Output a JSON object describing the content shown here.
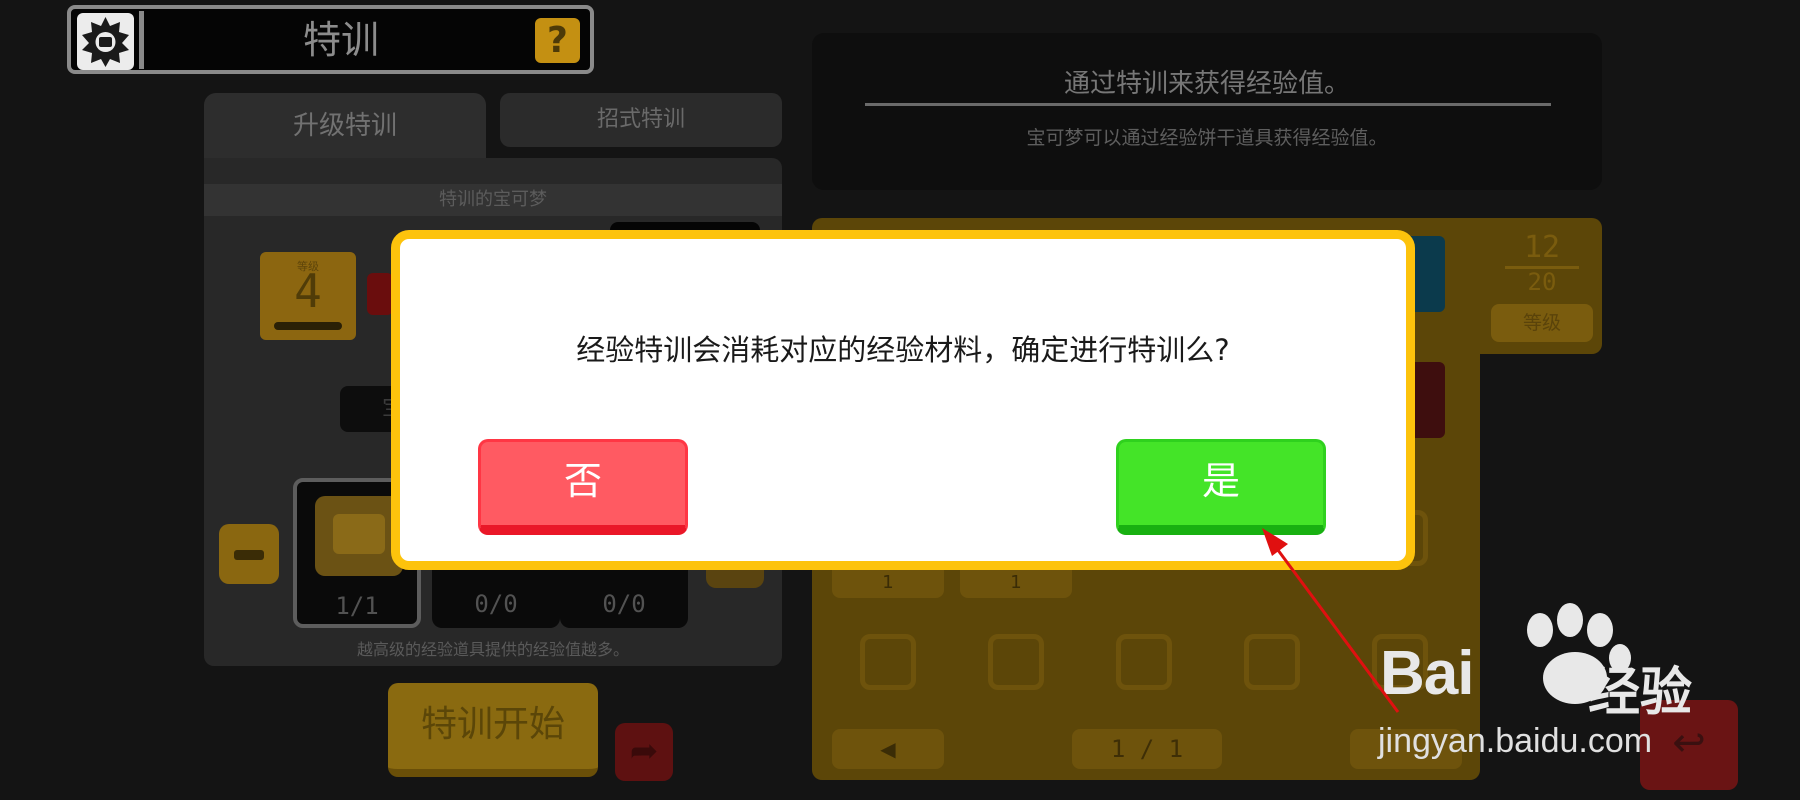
{
  "header": {
    "title": "特训",
    "help_icon": "?"
  },
  "tabs": [
    {
      "label": "升级特训"
    },
    {
      "label": "招式特训"
    }
  ],
  "left_panel": {
    "header": "特训的宝可梦",
    "level_label": "等级",
    "level_value": "4",
    "partial_button": "宝",
    "item_slots": [
      {
        "count": "1/1"
      },
      {
        "count": "0/0"
      },
      {
        "count": "0/0"
      }
    ],
    "footer": "越高级的经验道具提供的经验值越多。"
  },
  "start_button": "特训开始",
  "info": {
    "title": "通过特训来获得经验值。",
    "subtitle": "宝可梦可以通过经验饼干道具获得经验值。"
  },
  "right_panel": {
    "fraction_top": "12",
    "fraction_bottom": "20",
    "level_tag": "等级",
    "counts": [
      "1",
      "1"
    ],
    "page": "1 / 1",
    "prev_icon": "◀"
  },
  "dialog": {
    "message": "经验特训会消耗对应的经验材料，确定进行特训么?",
    "no_label": "否",
    "yes_label": "是"
  },
  "watermark": {
    "brand": "Bai",
    "brand_cn": "经验",
    "url": "jingyan.baidu.com"
  },
  "colors": {
    "dialog_border": "#fdc30c",
    "no_button": "#ff5a62",
    "yes_button": "#44e428",
    "arrow": "#e01010"
  }
}
